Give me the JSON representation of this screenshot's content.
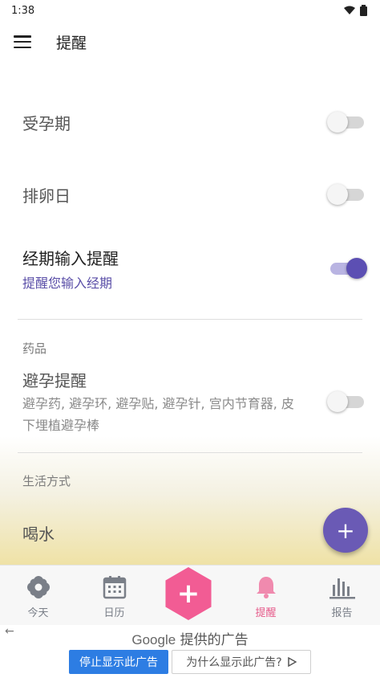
{
  "status": {
    "time": "1:38"
  },
  "app_bar": {
    "title": "提醒"
  },
  "settings": {
    "fertile": {
      "title": "受孕期",
      "on": false
    },
    "ovulation": {
      "title": "排卵日",
      "on": false
    },
    "period_input": {
      "title": "经期输入提醒",
      "subtitle": "提醒您输入经期",
      "on": true
    },
    "medicine_section": "药品",
    "contraception": {
      "title": "避孕提醒",
      "desc": "避孕药, 避孕环, 避孕贴, 避孕针, 宫内节育器, 皮下埋植避孕棒",
      "on": false
    },
    "lifestyle_section": "生活方式",
    "water": {
      "title": "喝水"
    }
  },
  "fab": {
    "icon": "plus-icon",
    "label": "+"
  },
  "bottom_nav": {
    "items": [
      {
        "label": "今天",
        "icon": "flower-icon"
      },
      {
        "label": "日历",
        "icon": "calendar-icon"
      },
      {
        "label": "+",
        "icon": "plus-icon"
      },
      {
        "label": "提醒",
        "icon": "bell-icon"
      },
      {
        "label": "报告",
        "icon": "bar-chart-icon"
      }
    ],
    "active": "提醒"
  },
  "ad": {
    "brand": "Google",
    "header_suffix": "提供的广告",
    "stop_button": "停止显示此广告",
    "why_button": "为什么显示此广告?"
  },
  "colors": {
    "accent": "#5c4fb3",
    "pink": "#f25c94",
    "active_nav": "#e65a8a",
    "ad_blue": "#2d7de3"
  }
}
